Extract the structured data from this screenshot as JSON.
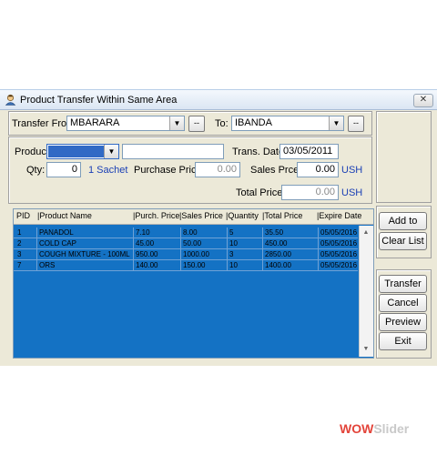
{
  "window": {
    "title": "Product Transfer Within Same Area",
    "close_label": "✕"
  },
  "transfer": {
    "from_label": "Transfer From:",
    "from_value": "MBARARA",
    "from_more": "--",
    "to_label": "To:",
    "to_value": "IBANDA",
    "to_more": "--"
  },
  "product": {
    "product_label": "Product:",
    "product_value": "",
    "product_name": "",
    "trans_date_label": "Trans. Date:",
    "trans_date_value": "03/05/2011",
    "qty_label": "Qty:",
    "qty_value": "0",
    "unit": "1 Sachet",
    "purchase_price_label": "Purchase Price:",
    "purchase_price_value": "0.00",
    "sales_price_label": "Sales Prce:",
    "sales_price_value": "0.00",
    "currency1": "USH",
    "total_price_label": "Total Price:",
    "total_price_value": "0.00",
    "currency2": "USH"
  },
  "table": {
    "columns": [
      "PID",
      "Product Name",
      "Purch. Price",
      "Sales Price",
      "Quantity",
      "Total Price",
      "Expire Date"
    ],
    "rows": [
      [
        "1",
        "PANADOL",
        "7.10",
        "8.00",
        "5",
        "35.50",
        "05/05/2016"
      ],
      [
        "2",
        "COLD CAP",
        "45.00",
        "50.00",
        "10",
        "450.00",
        "05/05/2016"
      ],
      [
        "3",
        "COUGH MIXTURE - 100ML",
        "950.00",
        "1000.00",
        "3",
        "2850.00",
        "05/05/2016"
      ],
      [
        "7",
        "ORS",
        "140.00",
        "150.00",
        "10",
        "1400.00",
        "05/05/2016"
      ]
    ]
  },
  "actions": {
    "add_to_list": "Add to List",
    "clear_list": "Clear List",
    "transfer": "Transfer",
    "cancel": "Cancel",
    "preview": "Preview",
    "exit": "Exit"
  },
  "watermark": {
    "text_part1": "WOW",
    "text_part2": "Slider"
  }
}
